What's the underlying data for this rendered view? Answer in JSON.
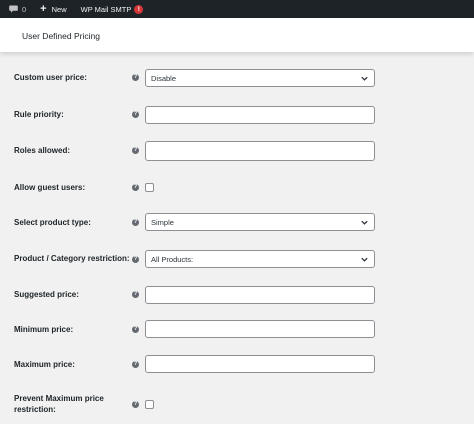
{
  "adminbar": {
    "comments_count": "0",
    "new_label": "New",
    "plugin_label": "WP Mail SMTP",
    "plugin_badge": "!"
  },
  "page": {
    "title": "User Defined Pricing"
  },
  "fields": {
    "custom_user_price": {
      "label": "Custom user price:",
      "value": "Disable"
    },
    "rule_priority": {
      "label": "Rule priority:",
      "value": ""
    },
    "roles_allowed": {
      "label": "Roles allowed:",
      "value": ""
    },
    "allow_guest_users": {
      "label": "Allow guest users:",
      "checked": false
    },
    "select_product_type": {
      "label": "Select product type:",
      "value": "Simple"
    },
    "product_category_restriction": {
      "label": "Product / Category restriction:",
      "value": "All Products:"
    },
    "suggested_price": {
      "label": "Suggested price:",
      "value": ""
    },
    "minimum_price": {
      "label": "Minimum price:",
      "value": ""
    },
    "maximum_price": {
      "label": "Maximum price:",
      "value": ""
    },
    "prevent_maximum_price_restriction": {
      "label_line1": "Prevent Maximum price",
      "label_line2": "restriction:",
      "checked": false
    }
  },
  "help_glyph": "?",
  "icons": [
    "comment-icon",
    "plus-icon",
    "help-icon",
    "chevron-down-icon"
  ],
  "colors": {
    "adminbar_bg": "#1d2327",
    "page_bg": "#f1f1f1",
    "badge": "#d63638",
    "border": "#8c8f94"
  }
}
